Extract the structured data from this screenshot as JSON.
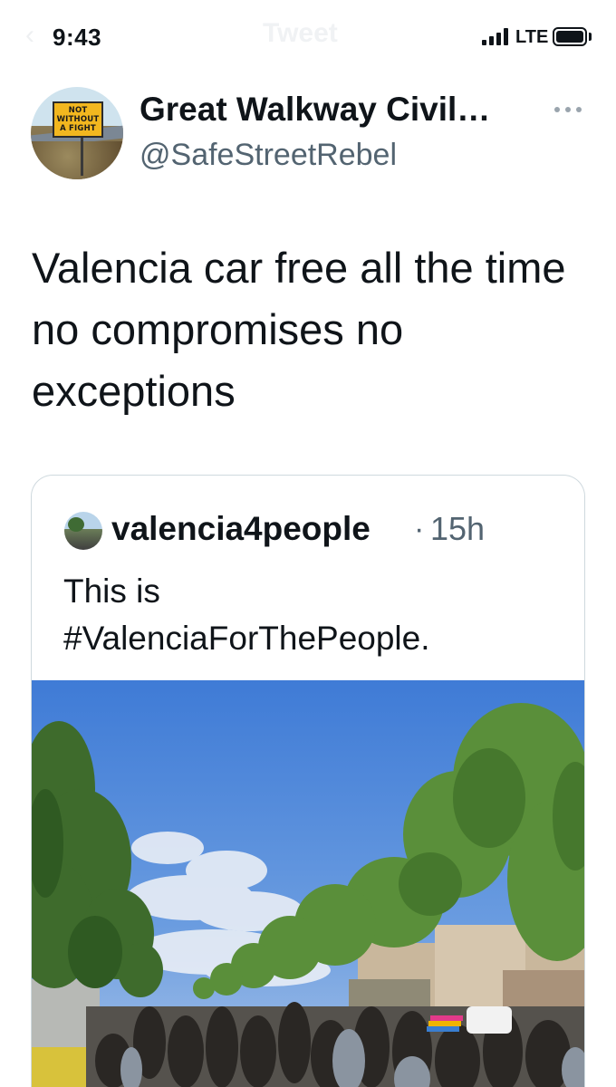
{
  "status_bar": {
    "time": "9:43",
    "network": "LTE",
    "faded_back": "‹",
    "faded_title": "Tweet"
  },
  "tweet": {
    "author": {
      "display_name": "Great Walkway Civil…",
      "handle": "@SafeStreetRebel",
      "avatar_sign_text": [
        "NOT",
        "WITHOUT",
        "A FIGHT"
      ]
    },
    "text": "Valencia car free all the time no compromises no exceptions"
  },
  "quoted_tweet": {
    "author": "valencia4people",
    "separator": "·",
    "time": "15h",
    "text_line1": "This is",
    "text_line2": "#ValenciaForThePeople."
  },
  "colors": {
    "text": "#0f1419",
    "secondary_text": "#536471",
    "border": "#cfd9de",
    "sky": "#3f7bd6"
  },
  "icons": {
    "more": "more-horizontal-icon",
    "signal": "cellular-signal-icon",
    "battery": "battery-icon"
  }
}
